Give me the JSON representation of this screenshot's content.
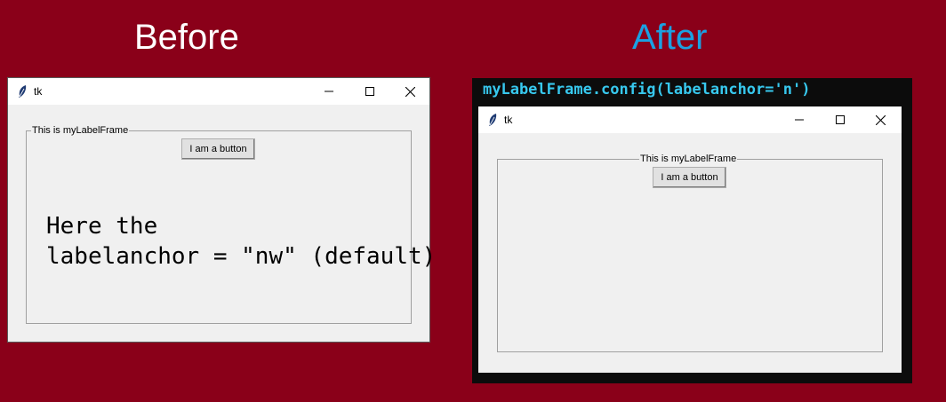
{
  "headings": {
    "before": "Before",
    "after": "After"
  },
  "before_window": {
    "title": "tk",
    "labelframe_label": "This is myLabelFrame",
    "button_label": "I am a button",
    "annotation_line1": "Here the",
    "annotation_line2": "labelanchor = \"nw\" (default)"
  },
  "after_panel": {
    "code": "myLabelFrame.config(labelanchor='n')"
  },
  "after_window": {
    "title": "tk",
    "labelframe_label": "This is myLabelFrame",
    "button_label": "I am a button"
  },
  "colors": {
    "background": "#8a0019",
    "after_heading": "#1ba1e2",
    "code_text": "#37c8ee"
  },
  "icons": [
    "feather-icon",
    "minimize-icon",
    "maximize-icon",
    "close-icon"
  ]
}
